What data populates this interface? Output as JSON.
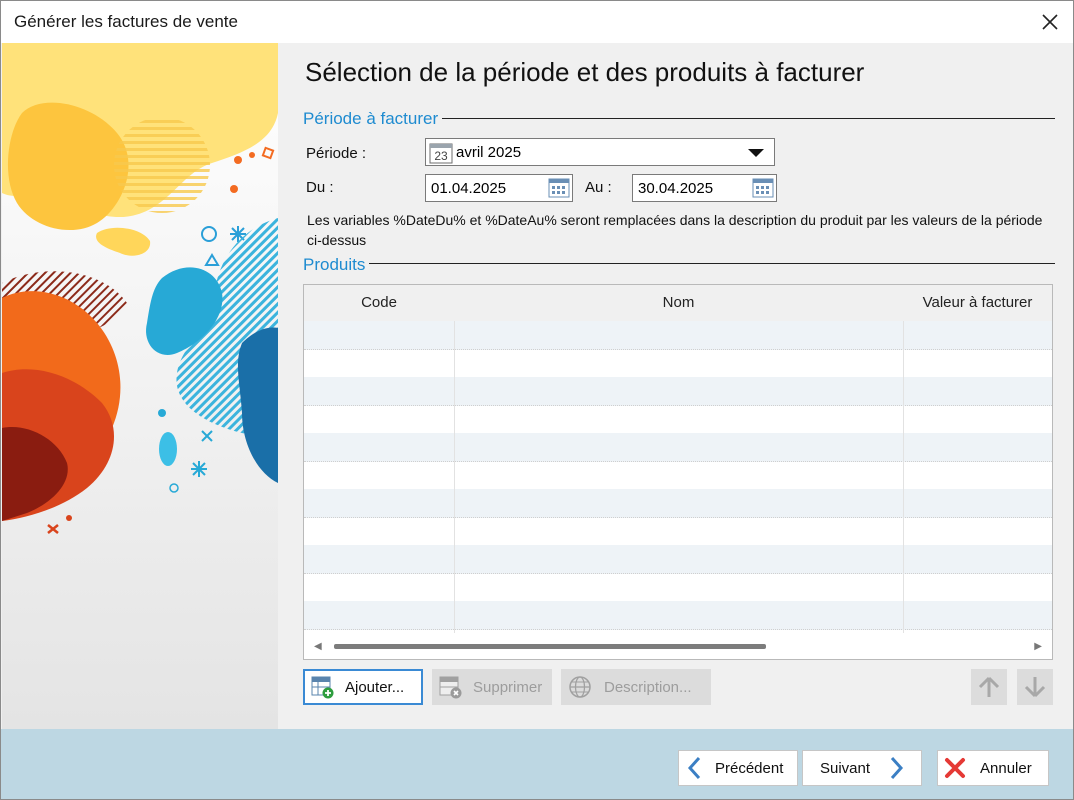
{
  "window": {
    "title": "Générer les factures de vente"
  },
  "heading": "Sélection de la période et des produits à facturer",
  "period_group": {
    "title": "Période à facturer",
    "periode_label": "Période :",
    "periode_value": "avril 2025",
    "calendar_day": "23",
    "du_label": "Du :",
    "du_value": "01.04.2025",
    "au_label": "Au :",
    "au_value": "30.04.2025",
    "note": "Les variables %DateDu% et %DateAu% seront remplacées dans la description du produit par les valeurs de la période ci-dessus"
  },
  "products_group": {
    "title": "Produits",
    "columns": [
      "Code",
      "Nom",
      "Valeur à facturer"
    ],
    "rows": []
  },
  "buttons": {
    "add": "Ajouter...",
    "delete": "Supprimer",
    "description": "Description..."
  },
  "footer": {
    "previous": "Précédent",
    "next": "Suivant",
    "cancel": "Annuler"
  },
  "colors": {
    "accent": "#1e8bd0",
    "footer_bg": "#bdd7e3",
    "cancel_red": "#e53935"
  }
}
